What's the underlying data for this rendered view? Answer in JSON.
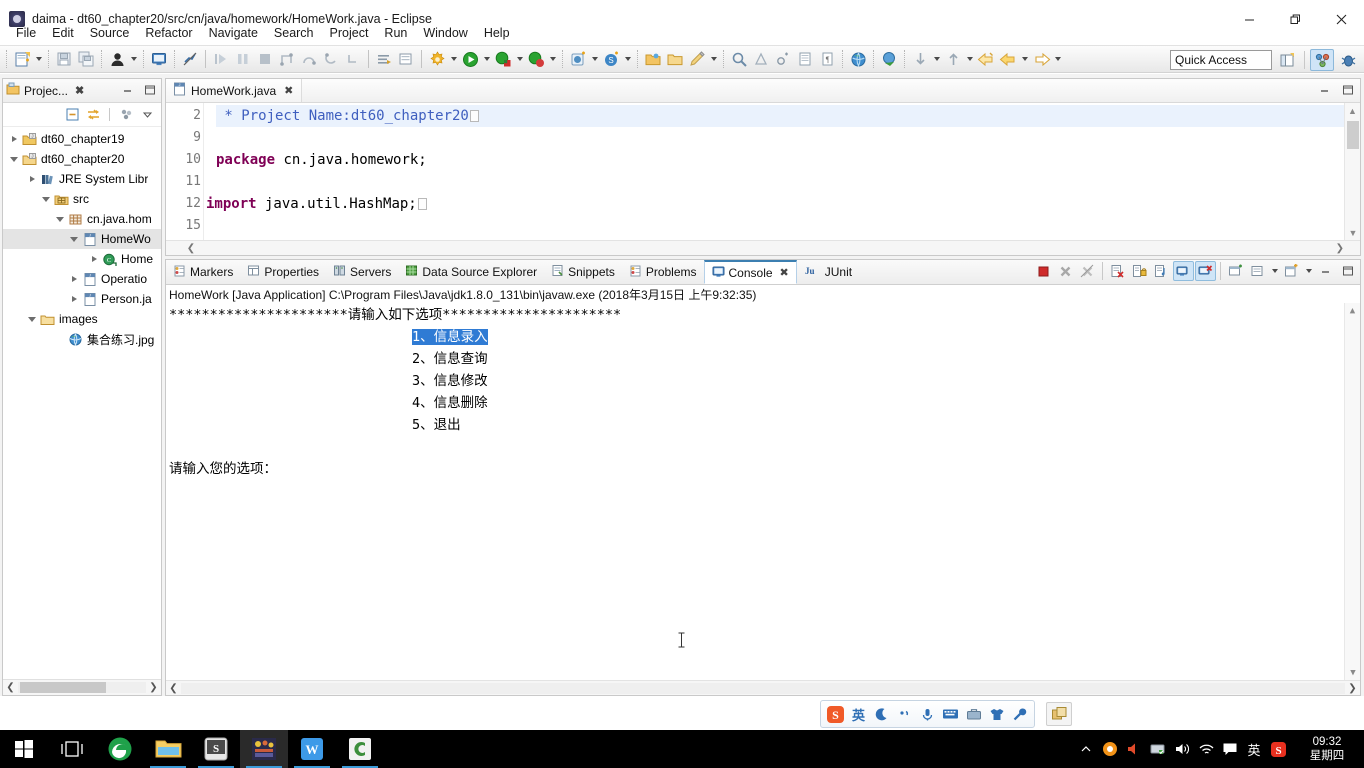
{
  "window": {
    "title": "daima - dt60_chapter20/src/cn/java/homework/HomeWork.java - Eclipse",
    "app_icon": "eclipse-icon",
    "minimize_label": "Minimize",
    "restore_label": "Restore",
    "close_label": "Close"
  },
  "menu": {
    "items": [
      {
        "label": "File"
      },
      {
        "label": "Edit"
      },
      {
        "label": "Source"
      },
      {
        "label": "Refactor"
      },
      {
        "label": "Navigate"
      },
      {
        "label": "Search"
      },
      {
        "label": "Project"
      },
      {
        "label": "Run"
      },
      {
        "label": "Window"
      },
      {
        "label": "Help"
      }
    ]
  },
  "toolbar": {
    "quick_access_placeholder": "Quick Access",
    "quick_access_value": "",
    "groups": [
      {
        "name": "new",
        "icons": [
          "new-wizard-icon",
          "new-dropdown-arrow"
        ]
      },
      {
        "name": "save",
        "icons": [
          "save-icon",
          "save-all-icon"
        ]
      },
      {
        "name": "person",
        "icons": [
          "person-icon",
          "person-dropdown-arrow"
        ]
      },
      {
        "name": "console",
        "icons": [
          "open-console-icon"
        ]
      },
      {
        "name": "annotation",
        "icons": [
          "toggle-annotation-icon"
        ]
      },
      {
        "name": "debug-step",
        "icons": [
          "resume-icon",
          "suspend-icon",
          "terminate-icon",
          "step-into-icon",
          "step-over-icon",
          "step-return-icon",
          "drop-to-frame-icon"
        ]
      },
      {
        "name": "edit-tools",
        "icons": [
          "toggle-mark-occurrences-icon",
          "open-type-icon"
        ]
      },
      {
        "name": "build",
        "icons": [
          "build-icon",
          "build-dropdown-arrow"
        ]
      },
      {
        "name": "run",
        "icons": [
          "run-icon",
          "run-dropdown-arrow",
          "debug-icon",
          "debug-dropdown-arrow",
          "coverage-icon",
          "coverage-dropdown-arrow"
        ]
      },
      {
        "name": "external-tools",
        "icons": [
          "external-tools-icon",
          "external-tools-dropdown-arrow",
          "svn-icon",
          "svn-dropdown-arrow"
        ]
      },
      {
        "name": "folders",
        "icons": [
          "open-folder-icon",
          "new-folder-icon",
          "pencil-icon",
          "pencil-dropdown-arrow"
        ]
      },
      {
        "name": "search",
        "icons": [
          "search-icon",
          "search-ref-icon",
          "java-search-icon",
          "next-annotation-icon",
          "previous-annotation-icon"
        ]
      },
      {
        "name": "web",
        "icons": [
          "web-browser-icon",
          "javadoc-icon"
        ]
      },
      {
        "name": "nav",
        "icons": [
          "next-edit-icon",
          "next-dropdown-arrow",
          "previous-edit-icon",
          "previous-dropdown-arrow",
          "back-icon",
          "forward-icon",
          "forward-dropdown-arrow",
          "last-edit-icon",
          "last-dropdown-arrow"
        ]
      }
    ],
    "perspectives": [
      "open-perspective-icon",
      "java-perspective-icon",
      "debug-perspective-icon"
    ]
  },
  "package_explorer": {
    "tab_label": "Projec...",
    "tab_icon": "package-explorer-icon",
    "tab_close_icon": "close-icon",
    "minimize_icon": "minimize-icon",
    "maximize_icon": "maximize-icon",
    "toolbar_icons": [
      "collapse-all-icon",
      "link-with-editor-icon",
      "view-menu-icon",
      "view-dropdown-icon"
    ],
    "tree": [
      {
        "label": "dt60_chapter19",
        "icon": "java-project-icon",
        "indent": 0,
        "state": "collapsed",
        "selected": false
      },
      {
        "label": "dt60_chapter20",
        "icon": "java-project-open-icon",
        "indent": 0,
        "state": "expanded",
        "selected": false
      },
      {
        "label": "JRE System Libr",
        "icon": "library-icon",
        "indent": 1,
        "state": "collapsed",
        "selected": false
      },
      {
        "label": "src",
        "icon": "source-folder-icon",
        "indent": 1,
        "state": "expanded",
        "selected": false
      },
      {
        "label": "cn.java.hom",
        "icon": "package-icon",
        "indent": 2,
        "state": "expanded",
        "selected": false
      },
      {
        "label": "HomeWo",
        "icon": "java-file-icon",
        "indent": 3,
        "state": "expanded",
        "selected": true
      },
      {
        "label": "Home",
        "icon": "java-class-icon",
        "indent": 4,
        "state": "collapsed",
        "selected": false
      },
      {
        "label": "Operatio",
        "icon": "java-file-icon",
        "indent": 3,
        "state": "collapsed",
        "selected": false
      },
      {
        "label": "Person.ja",
        "icon": "java-file-icon",
        "indent": 3,
        "state": "collapsed",
        "selected": false
      },
      {
        "label": "images",
        "icon": "folder-icon",
        "indent": 1,
        "state": "expanded",
        "selected": false
      },
      {
        "label": "集合练习.jpg",
        "icon": "image-file-icon",
        "indent": 2,
        "state": "leaf",
        "selected": false
      }
    ],
    "hscroll_left_icon": "scroll-left-icon",
    "hscroll_right_icon": "scroll-right-icon"
  },
  "editor": {
    "tab_label": "HomeWork.java",
    "tab_icon": "java-file-icon",
    "tab_close_icon": "close-icon",
    "minimize_icon": "minimize-icon",
    "maximize_icon": "maximize-icon",
    "lines": [
      {
        "number": "2",
        "fold": true,
        "highlight": true,
        "segments": [
          {
            "text": " * Project Name:dt60_chapter20",
            "style": "comment"
          }
        ],
        "placeholder": true
      },
      {
        "number": "9",
        "fold": false,
        "highlight": false,
        "segments": [
          {
            "text": "",
            "style": "plain"
          }
        ],
        "placeholder": false
      },
      {
        "number": "10",
        "fold": false,
        "highlight": false,
        "segments": [
          {
            "text": "package",
            "style": "keyword"
          },
          {
            "text": " cn.java.homework;",
            "style": "plain"
          }
        ],
        "placeholder": false
      },
      {
        "number": "11",
        "fold": false,
        "highlight": false,
        "segments": [
          {
            "text": "",
            "style": "plain"
          }
        ],
        "placeholder": false
      },
      {
        "number": "12",
        "fold": true,
        "highlight": false,
        "segments": [
          {
            "text": "import",
            "style": "keyword"
          },
          {
            "text": " java.util.HashMap;",
            "style": "plain"
          }
        ],
        "placeholder": true
      },
      {
        "number": "15",
        "fold": false,
        "highlight": false,
        "segments": [
          {
            "text": "",
            "style": "plain"
          }
        ],
        "placeholder": false
      }
    ]
  },
  "console_view": {
    "tabs": [
      {
        "label": "Markers",
        "icon": "markers-icon",
        "active": false
      },
      {
        "label": "Properties",
        "icon": "properties-icon",
        "active": false
      },
      {
        "label": "Servers",
        "icon": "servers-icon",
        "active": false
      },
      {
        "label": "Data Source Explorer",
        "icon": "data-source-icon",
        "active": false
      },
      {
        "label": "Snippets",
        "icon": "snippets-icon",
        "active": false
      },
      {
        "label": "Problems",
        "icon": "problems-icon",
        "active": false
      },
      {
        "label": "Console",
        "icon": "console-icon",
        "active": true,
        "close_icon": "close-icon"
      },
      {
        "label": "JUnit",
        "icon": "junit-icon",
        "active": false
      }
    ],
    "toolbar_icons": [
      "terminate-icon",
      "remove-launch-icon",
      "remove-all-launches-icon",
      "clear-console-icon",
      "scroll-lock-icon",
      "word-wrap-icon",
      "show-console-on-output-icon",
      "show-console-on-error-icon",
      "pin-console-icon",
      "display-selected-console-icon",
      "display-dropdown-arrow",
      "open-console-icon",
      "open-console-dropdown-arrow",
      "minimize-icon",
      "maximize-icon"
    ],
    "launch_line": "HomeWork [Java Application] C:\\Program Files\\Java\\jdk1.8.0_131\\bin\\javaw.exe (2018年3月15日 上午9:32:35)",
    "output_lines": [
      {
        "text": "**********************请输入如下选项**********************",
        "indent": 0,
        "highlight": null
      },
      {
        "text": "1、信息录入",
        "indent": 30,
        "highlight": "1、信息录入"
      },
      {
        "text": "2、信息查询",
        "indent": 30,
        "highlight": null
      },
      {
        "text": "3、信息修改",
        "indent": 30,
        "highlight": null
      },
      {
        "text": "4、信息删除",
        "indent": 30,
        "highlight": null
      },
      {
        "text": "5、退出",
        "indent": 30,
        "highlight": null
      },
      {
        "text": "",
        "indent": 0,
        "highlight": null
      },
      {
        "text": "请输入您的选项：",
        "indent": 0,
        "highlight": null
      }
    ],
    "selection_color": "#2f7bd4",
    "caret_icon": "text-cursor-icon"
  },
  "ime_bar": {
    "icons": [
      {
        "name": "sogou-logo-icon",
        "label": "S"
      },
      {
        "name": "chinese-english-toggle-icon",
        "label": "英"
      },
      {
        "name": "moon-icon",
        "label": ""
      },
      {
        "name": "punctuation-icon",
        "label": ""
      },
      {
        "name": "voice-input-icon",
        "label": ""
      },
      {
        "name": "soft-keyboard-icon",
        "label": ""
      },
      {
        "name": "toolbox-icon",
        "label": ""
      },
      {
        "name": "skin-icon",
        "label": ""
      },
      {
        "name": "settings-wrench-icon",
        "label": ""
      }
    ],
    "extra_icon": "ime-extra-icon"
  },
  "taskbar": {
    "start_icon": "windows-start-icon",
    "items": [
      {
        "name": "task-view-icon",
        "running": false,
        "active": false
      },
      {
        "name": "edge-browser-icon",
        "running": false,
        "active": false
      },
      {
        "name": "file-explorer-icon",
        "running": true,
        "active": false
      },
      {
        "name": "sogou-app-icon",
        "running": true,
        "active": false
      },
      {
        "name": "eclipse-app-icon",
        "running": true,
        "active": true
      },
      {
        "name": "wps-writer-icon",
        "running": true,
        "active": false
      },
      {
        "name": "c-app-icon",
        "running": true,
        "active": false
      }
    ],
    "tray": [
      {
        "name": "show-hidden-icons-icon"
      },
      {
        "name": "antivirus-icon"
      },
      {
        "name": "volume-mute-icon"
      },
      {
        "name": "network-share-icon"
      },
      {
        "name": "speaker-icon"
      },
      {
        "name": "wifi-icon"
      },
      {
        "name": "action-center-icon"
      },
      {
        "name": "ime-indicator-icon",
        "label": "英"
      },
      {
        "name": "sogou-tray-icon"
      }
    ],
    "clock": {
      "time": "09:32",
      "day": "星期四"
    }
  },
  "colors": {
    "accent": "#2f7bd4",
    "tab_active_border": "#3c7fb1",
    "keyword": "#7f0055",
    "comment": "#3f5fbf",
    "taskbar_bg": "#000000",
    "selection_bg": "#e4e4e4"
  }
}
